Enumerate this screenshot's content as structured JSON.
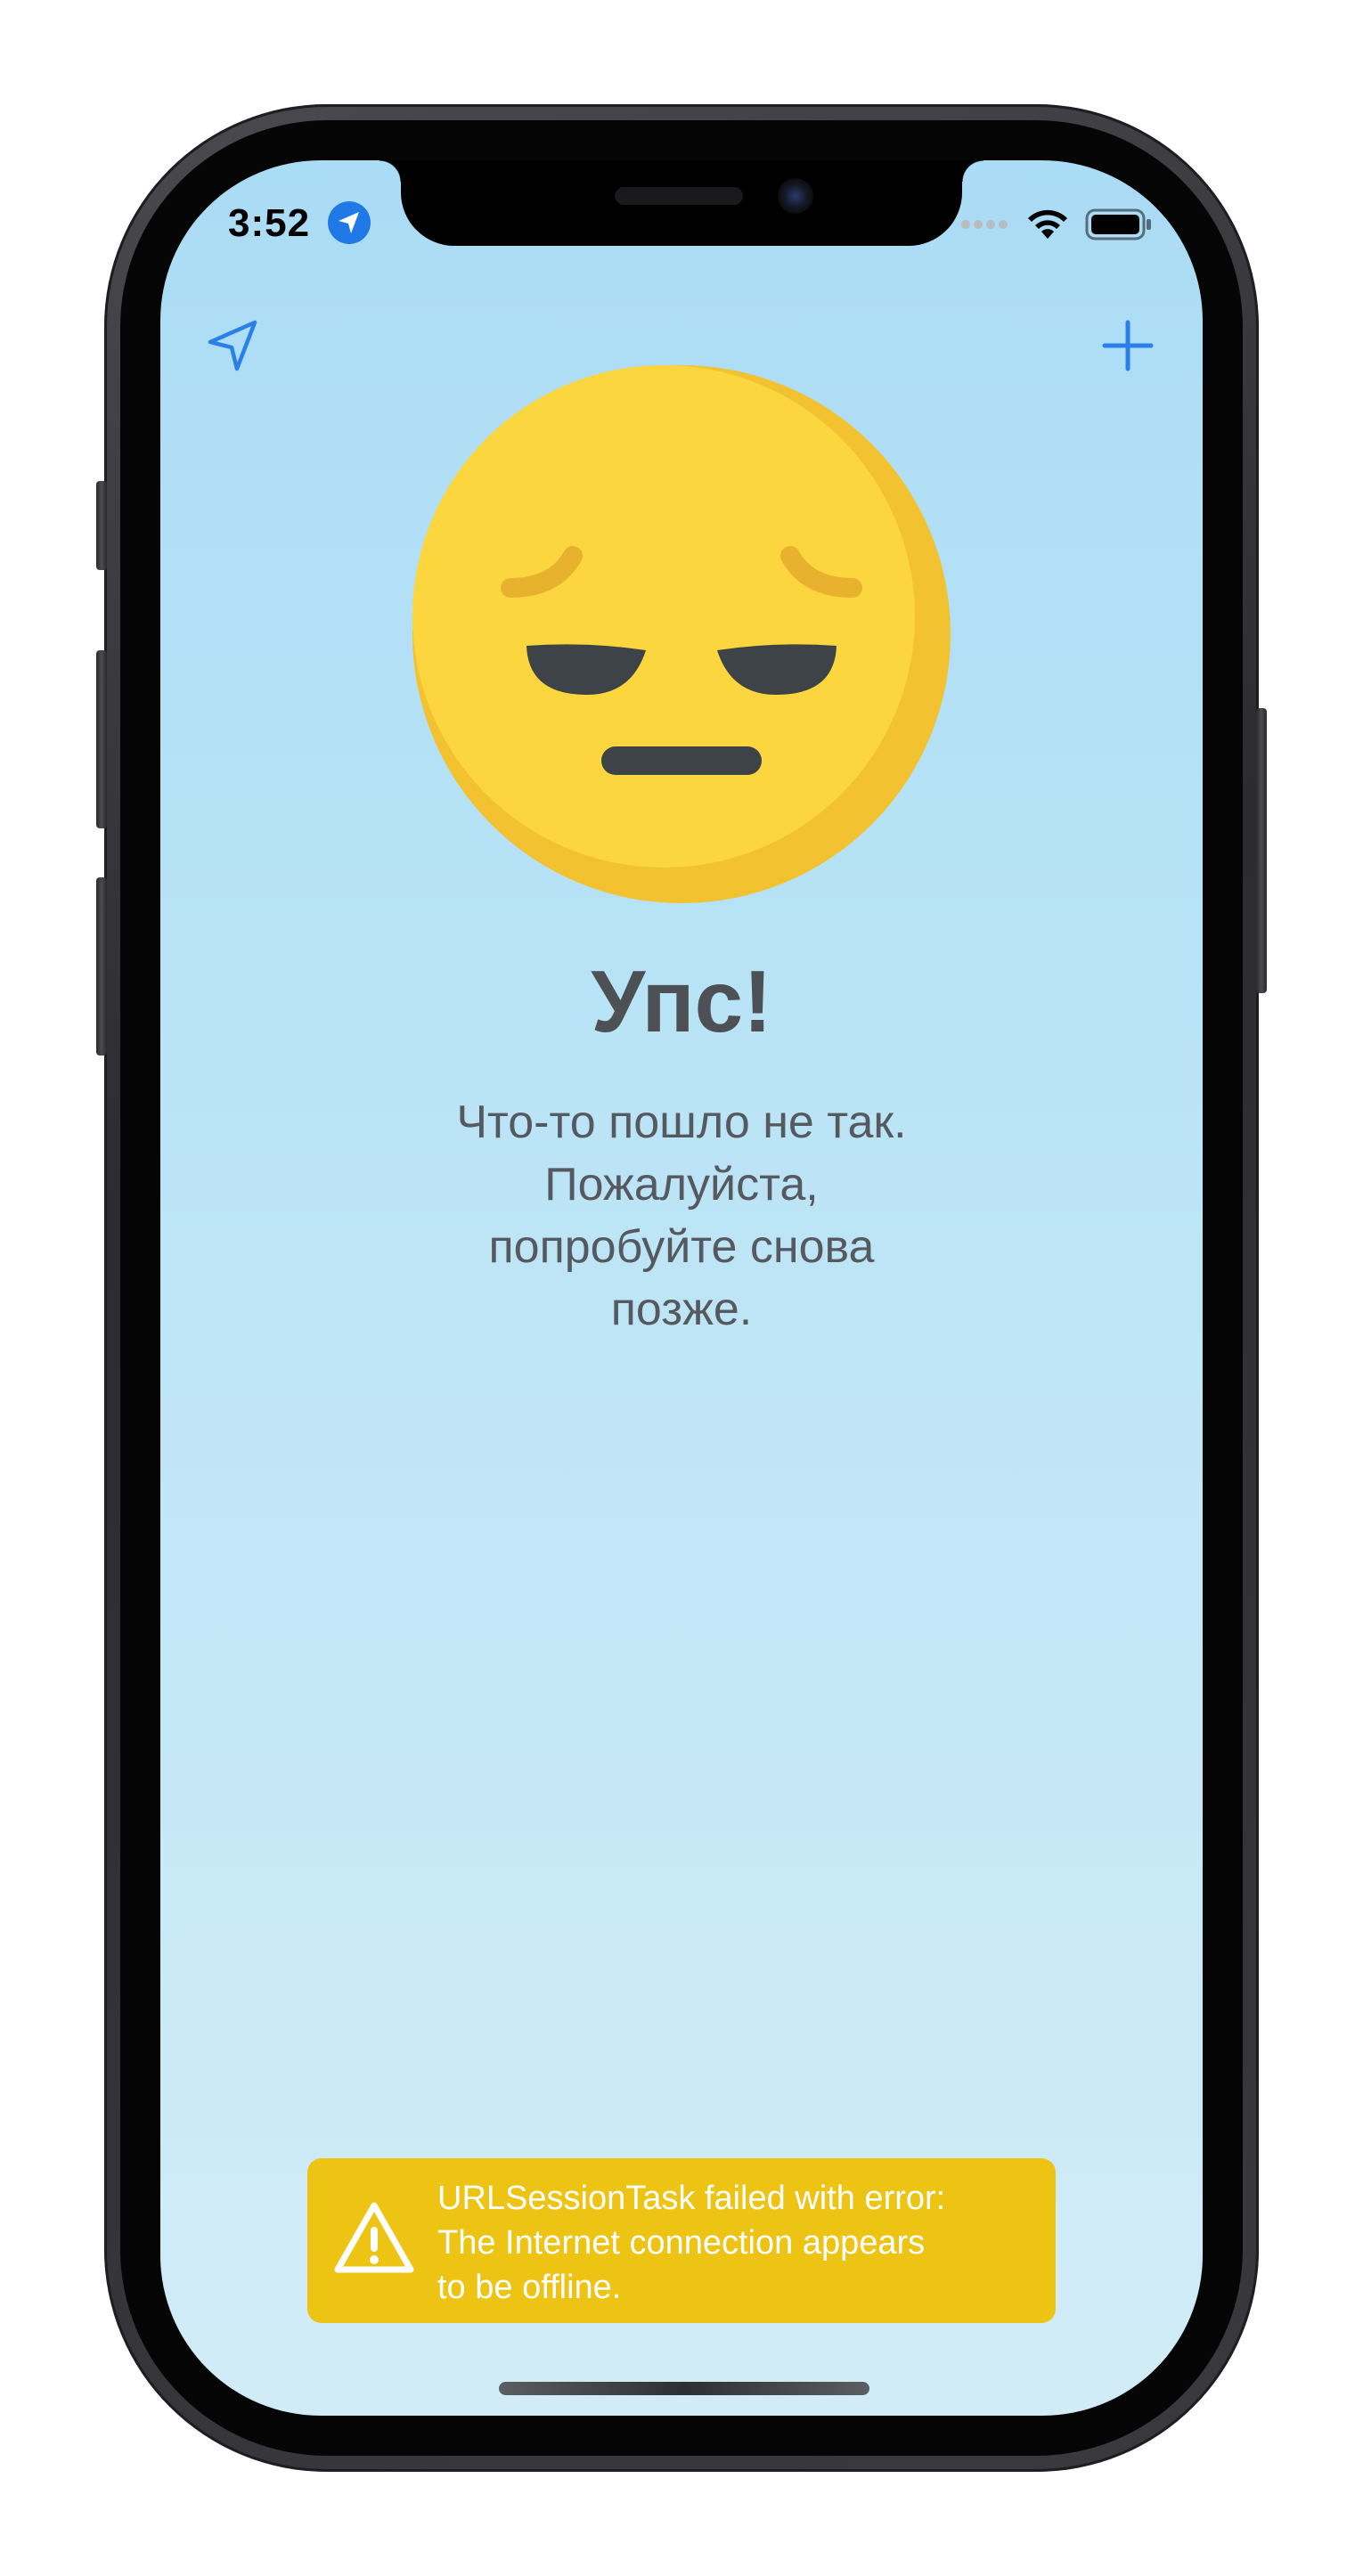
{
  "status_bar": {
    "time": "3:52",
    "location_icon": "location-arrow-filled-icon",
    "signal_icon": "cellular-dots-icon",
    "wifi_icon": "wifi-icon",
    "battery_icon": "battery-full-icon"
  },
  "nav": {
    "left_icon": "location-arrow-icon",
    "right_icon": "plus-icon",
    "accent_color": "#2a7fe8"
  },
  "error": {
    "emoji": "pensive-face-emoji",
    "title": "Упс!",
    "message_lines": [
      "Что-то пошло не так.",
      "Пожалуйста,",
      "попробуйте снова",
      "позже."
    ]
  },
  "toast": {
    "icon": "warning-triangle-icon",
    "lines": [
      "URLSessionTask failed with error:",
      "The Internet connection appears",
      "to be offline."
    ],
    "background": "#edc414"
  }
}
